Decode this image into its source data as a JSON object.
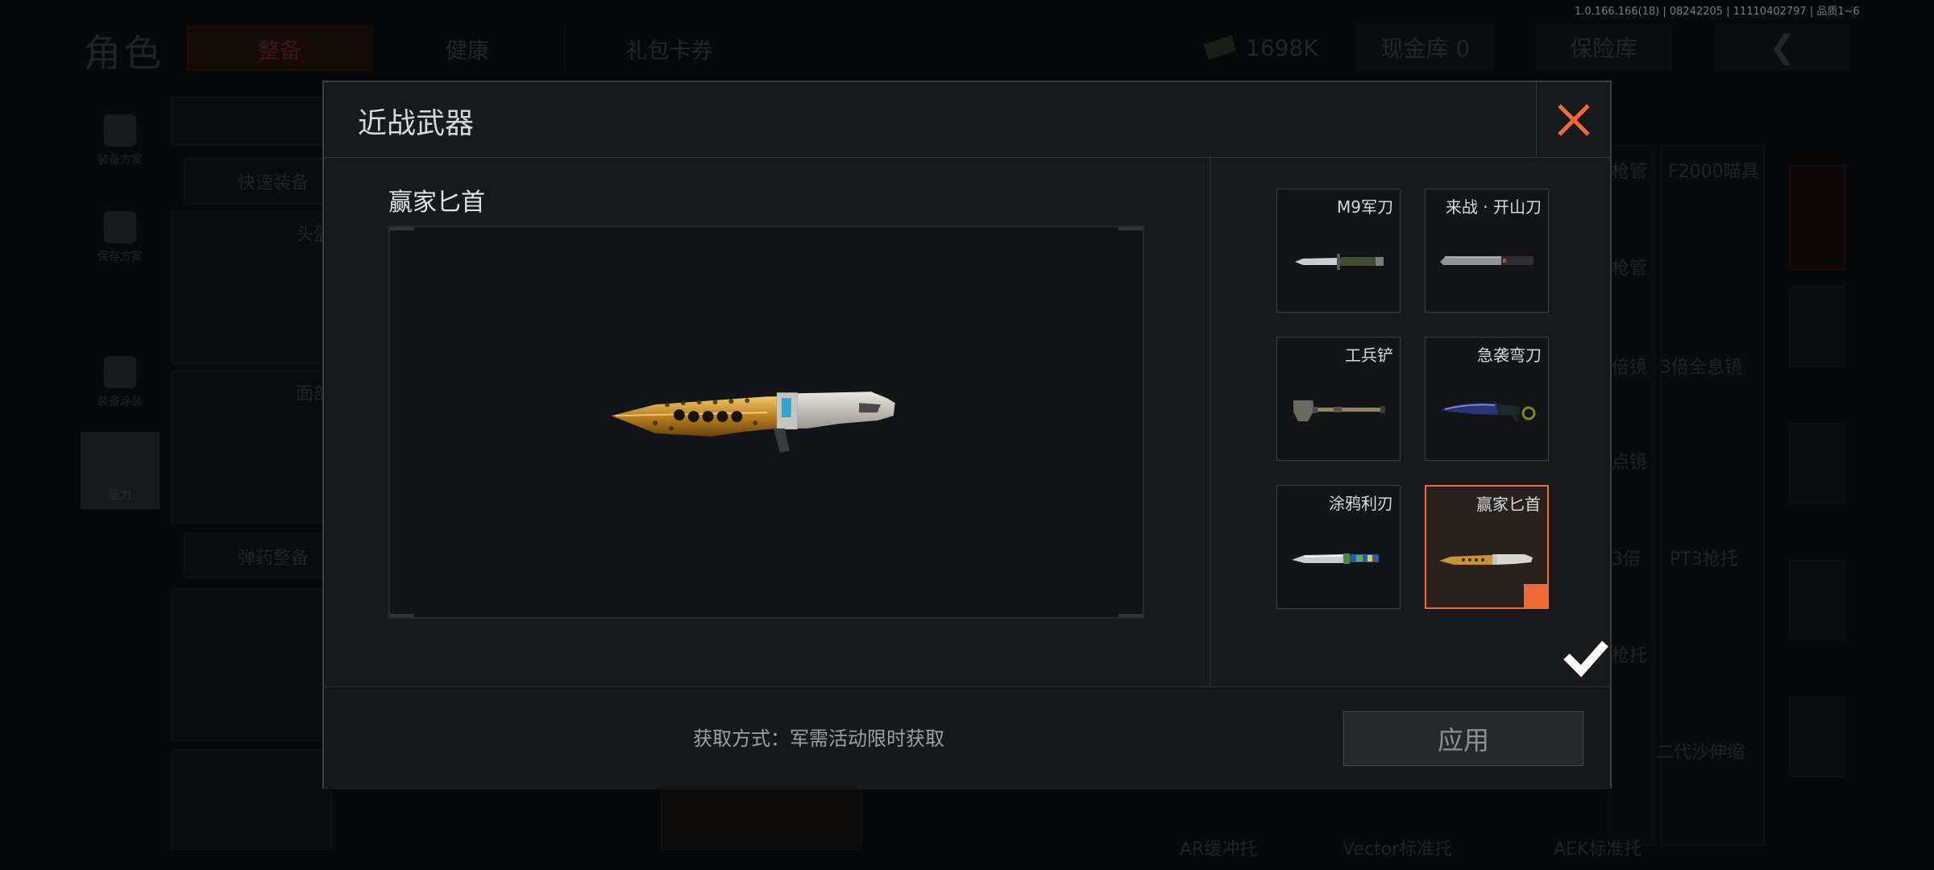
{
  "background": {
    "title": "角色",
    "tabs": [
      "整备",
      "健康",
      "礼包卡券"
    ],
    "money": "1698K",
    "cash_vault": "现金库 0",
    "insurance": "保险库",
    "back_glyph": "❮",
    "version": "1.0.166.166(18) | 08242205 | 11110402797 | 品质1~6",
    "left_nav": [
      "装备方案",
      "保存方案",
      "装备涂装",
      "能力"
    ],
    "labels": {
      "quick_equip": "快速装备",
      "head": "头盔",
      "face": "面部",
      "ammo": "弹药整备"
    },
    "right_labels": [
      "枪管",
      "F2000瞄具",
      "枪管",
      "倍镜",
      "3倍全息镜",
      "点镜",
      "3倍",
      "PT3枪托",
      "枪托",
      "二代沙伸缩",
      "AR缓冲托",
      "Vector标准托",
      "AEK标准托"
    ]
  },
  "dialog": {
    "title": "近战武器",
    "close_glyph": "✕",
    "selected_name": "赢家匕首",
    "acquire_text": "获取方式：军需活动限时获取",
    "apply_label": "应用",
    "check_glyph": "✓",
    "items": [
      {
        "name": "M9军刀",
        "icon": "bayonet-icon",
        "selected": false
      },
      {
        "name": "来战 · 开山刀",
        "icon": "machete-icon",
        "selected": false
      },
      {
        "name": "工兵铲",
        "icon": "shovel-icon",
        "selected": false
      },
      {
        "name": "急袭弯刀",
        "icon": "karambit-icon",
        "selected": false
      },
      {
        "name": "涂鸦利刃",
        "icon": "graffiti-knife-icon",
        "selected": false
      },
      {
        "name": "赢家匕首",
        "icon": "gold-dagger-icon",
        "selected": true
      }
    ]
  },
  "colors": {
    "accent": "#f06a36",
    "gold": "#c9932e",
    "panel": "#17191b"
  }
}
